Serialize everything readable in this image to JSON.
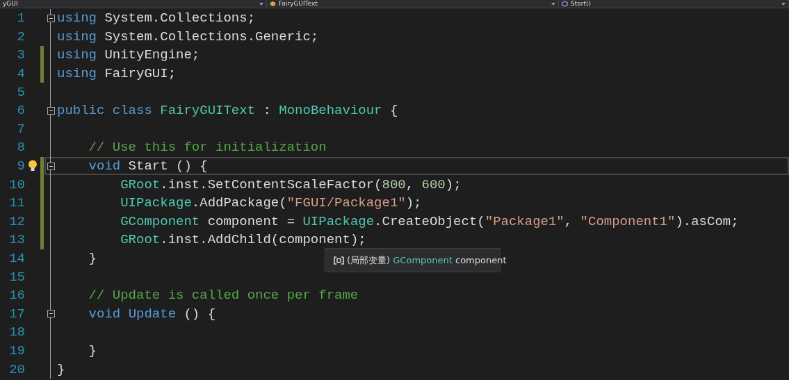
{
  "navigation_bar": [
    {
      "label": "yGUI",
      "kind": "project"
    },
    {
      "label": "FairyGUIText",
      "kind": "class"
    },
    {
      "label": "Start()",
      "kind": "method"
    }
  ],
  "lines": [
    {
      "number": "1",
      "modified": false,
      "current": false,
      "lightbulb": false,
      "foldable": true,
      "tokens": [
        {
          "text": "using",
          "kind": "keyword"
        },
        {
          "text": " System.Collections;",
          "kind": "plain"
        }
      ]
    },
    {
      "number": "2",
      "modified": false,
      "current": false,
      "lightbulb": false,
      "foldable": false,
      "tokens": [
        {
          "text": "using",
          "kind": "keyword"
        },
        {
          "text": " System.Collections.Generic;",
          "kind": "plain"
        }
      ]
    },
    {
      "number": "3",
      "modified": true,
      "current": false,
      "lightbulb": false,
      "foldable": false,
      "tokens": [
        {
          "text": "using",
          "kind": "keyword"
        },
        {
          "text": " UnityEngine;",
          "kind": "plain"
        }
      ]
    },
    {
      "number": "4",
      "modified": true,
      "current": false,
      "lightbulb": false,
      "foldable": false,
      "tokens": [
        {
          "text": "using",
          "kind": "keyword"
        },
        {
          "text": " FairyGUI;",
          "kind": "plain"
        }
      ]
    },
    {
      "number": "5",
      "modified": false,
      "current": false,
      "lightbulb": false,
      "foldable": false
    },
    {
      "number": "6",
      "modified": false,
      "current": false,
      "lightbulb": false,
      "foldable": true,
      "tokens": [
        {
          "text": "public class ",
          "kind": "keyword"
        },
        {
          "text": "FairyGUIText",
          "kind": "type"
        },
        {
          "text": " : ",
          "kind": "plain"
        },
        {
          "text": "MonoBehaviour",
          "kind": "type"
        },
        {
          "text": " {",
          "kind": "plain"
        }
      ]
    },
    {
      "number": "7",
      "modified": false,
      "current": false,
      "lightbulb": false,
      "foldable": false
    },
    {
      "number": "8",
      "modified": false,
      "current": false,
      "lightbulb": false,
      "foldable": false,
      "tokens": [
        {
          "text": "    // Use this for initialization",
          "kind": "comment"
        }
      ]
    },
    {
      "number": "9",
      "modified": true,
      "current": true,
      "lightbulb": true,
      "foldable": true,
      "tokens": [
        {
          "text": "    void",
          "kind": "keyword"
        },
        {
          "text": " Start () {",
          "kind": "plain"
        }
      ]
    },
    {
      "number": "10",
      "modified": true,
      "current": false,
      "lightbulb": false,
      "foldable": false,
      "tokens": [
        {
          "text": "        GRoot",
          "kind": "type"
        },
        {
          "text": ".inst.SetContentScaleFactor(",
          "kind": "plain"
        },
        {
          "text": "800",
          "kind": "number"
        },
        {
          "text": ", ",
          "kind": "plain"
        },
        {
          "text": "600",
          "kind": "number"
        },
        {
          "text": ");",
          "kind": "plain"
        }
      ]
    },
    {
      "number": "11",
      "modified": true,
      "current": false,
      "lightbulb": false,
      "foldable": false,
      "tokens": [
        {
          "text": "        UIPackage",
          "kind": "type"
        },
        {
          "text": ".AddPackage(",
          "kind": "plain"
        },
        {
          "text": "\"FGUI/Package1\"",
          "kind": "string"
        },
        {
          "text": ");",
          "kind": "plain"
        }
      ]
    },
    {
      "number": "12",
      "modified": true,
      "current": false,
      "lightbulb": false,
      "foldable": false,
      "tokens": [
        {
          "text": "        GComponent",
          "kind": "type"
        },
        {
          "text": " component = ",
          "kind": "plain"
        },
        {
          "text": "UIPackage",
          "kind": "type"
        },
        {
          "text": ".CreateObject(",
          "kind": "plain"
        },
        {
          "text": "\"Package1\"",
          "kind": "string"
        },
        {
          "text": ", ",
          "kind": "plain"
        },
        {
          "text": "\"Component1\"",
          "kind": "string"
        },
        {
          "text": ").asCom;",
          "kind": "plain"
        }
      ]
    },
    {
      "number": "13",
      "modified": true,
      "current": false,
      "lightbulb": false,
      "foldable": false,
      "tokens": [
        {
          "text": "        GRoot",
          "kind": "type"
        },
        {
          "text": ".inst.AddChild(component);",
          "kind": "plain"
        }
      ]
    },
    {
      "number": "14",
      "modified": false,
      "current": false,
      "lightbulb": false,
      "foldable": false,
      "tokens": [
        {
          "text": "    }",
          "kind": "plain"
        }
      ]
    },
    {
      "number": "15",
      "modified": false,
      "current": false,
      "lightbulb": false,
      "foldable": false
    },
    {
      "number": "16",
      "modified": false,
      "current": false,
      "lightbulb": false,
      "foldable": false,
      "tokens": [
        {
          "text": "    // Update is called once per frame",
          "kind": "comment"
        }
      ]
    },
    {
      "number": "17",
      "modified": false,
      "current": false,
      "lightbulb": false,
      "foldable": true,
      "tokens": [
        {
          "text": "    void ",
          "kind": "keyword"
        },
        {
          "text": "Update",
          "kind": "method"
        },
        {
          "text": " () {",
          "kind": "plain"
        }
      ]
    },
    {
      "number": "18",
      "modified": false,
      "current": false,
      "lightbulb": false,
      "foldable": false
    },
    {
      "number": "19",
      "modified": false,
      "current": false,
      "lightbulb": false,
      "foldable": false,
      "tokens": [
        {
          "text": "    }",
          "kind": "plain"
        }
      ]
    },
    {
      "number": "20",
      "modified": false,
      "current": false,
      "lightbulb": false,
      "foldable": false,
      "tokens": [
        {
          "text": "}",
          "kind": "plain"
        }
      ]
    }
  ],
  "tooltip": {
    "tokens": [
      {
        "text": "(局部变量)",
        "kind": "plain"
      },
      {
        "text": "GComponent",
        "kind": "type"
      },
      {
        "text": "component",
        "kind": "plain"
      }
    ]
  }
}
